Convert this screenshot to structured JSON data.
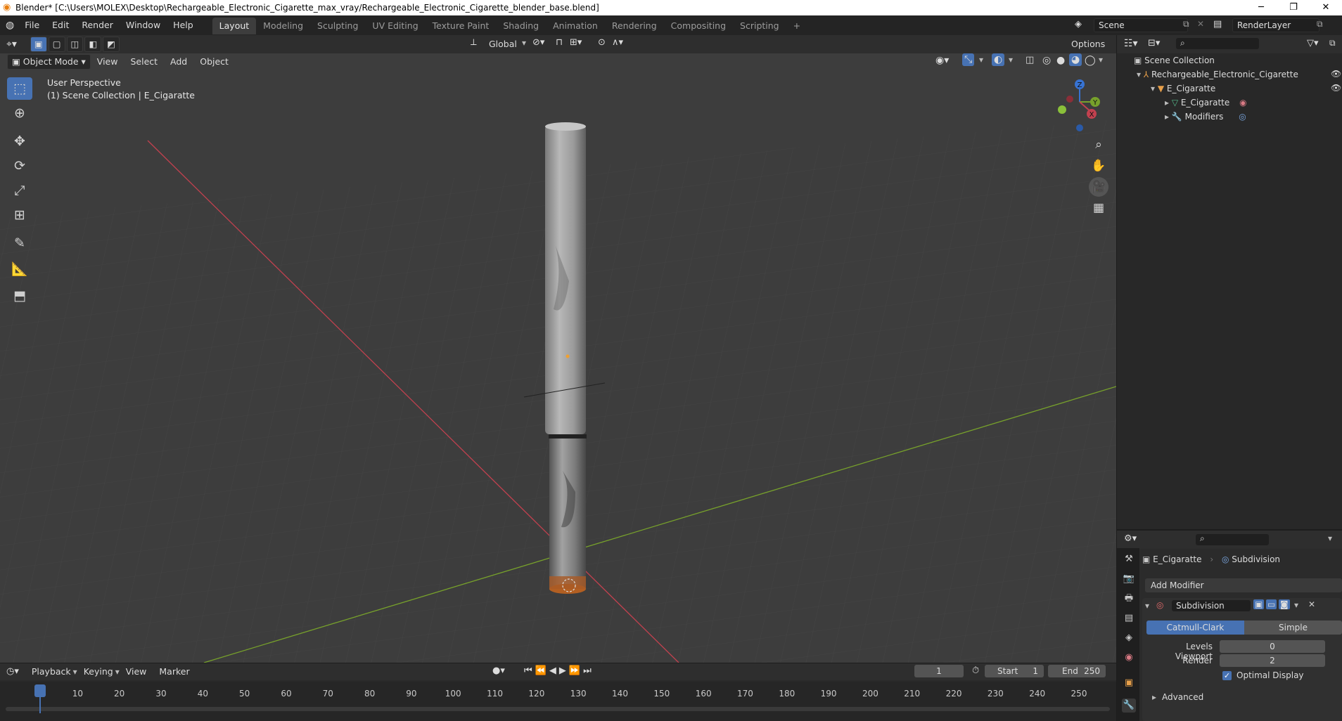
{
  "window": {
    "title": "Blender* [C:\\Users\\MOLEX\\Desktop\\Rechargeable_Electronic_Cigarette_max_vray/Rechargeable_Electronic_Cigarette_blender_base.blend]",
    "min": "─",
    "max": "❐",
    "close": "✕"
  },
  "menubar": {
    "menus": [
      "File",
      "Edit",
      "Render",
      "Window",
      "Help"
    ],
    "workspaces": [
      "Layout",
      "Modeling",
      "Sculpting",
      "UV Editing",
      "Texture Paint",
      "Shading",
      "Animation",
      "Rendering",
      "Compositing",
      "Scripting"
    ],
    "active_workspace": "Layout",
    "add_tab": "+",
    "scene": "Scene",
    "render_layer": "RenderLayer"
  },
  "viewport_header": {
    "mode": "Object Mode",
    "menus": [
      "View",
      "Select",
      "Add",
      "Object"
    ],
    "transform_orientation": "Global",
    "options": "Options"
  },
  "viewport": {
    "perspective_label": "User Perspective",
    "collection_label": "(1) Scene Collection | E_Cigaratte",
    "gizmo": {
      "z": "Z",
      "y": "Y",
      "x": "X"
    }
  },
  "outliner": {
    "root": "Scene Collection",
    "items": [
      {
        "label": "Rechargeable_Electronic_Cigarette"
      },
      {
        "label": "E_Cigaratte"
      },
      {
        "label": "E_Cigaratte"
      },
      {
        "label": "Modifiers"
      }
    ]
  },
  "properties": {
    "object_name": "E_Cigaratte",
    "modifier_context": "Subdivision",
    "add_modifier": "Add Modifier",
    "modifier": {
      "name": "Subdivision",
      "type_options": [
        "Catmull-Clark",
        "Simple"
      ],
      "active_type": "Catmull-Clark",
      "levels_viewport_label": "Levels Viewport",
      "levels_viewport": "0",
      "render_label": "Render",
      "render": "2",
      "optimal_display_label": "Optimal Display",
      "optimal_display": true,
      "advanced": "Advanced"
    }
  },
  "timeline": {
    "menus": [
      "Playback",
      "Keying",
      "View",
      "Marker"
    ],
    "current_frame": "1",
    "start_label": "Start",
    "start": "1",
    "end_label": "End",
    "end": "250",
    "ticks": [
      "1",
      "10",
      "20",
      "30",
      "40",
      "50",
      "60",
      "70",
      "80",
      "90",
      "100",
      "110",
      "120",
      "130",
      "140",
      "150",
      "160",
      "170",
      "180",
      "190",
      "200",
      "210",
      "220",
      "230",
      "240",
      "250"
    ]
  },
  "colors": {
    "accent": "#4772b3",
    "x_axis": "#c2414f",
    "y_axis": "#77a12b",
    "z_axis": "#3773d3"
  }
}
